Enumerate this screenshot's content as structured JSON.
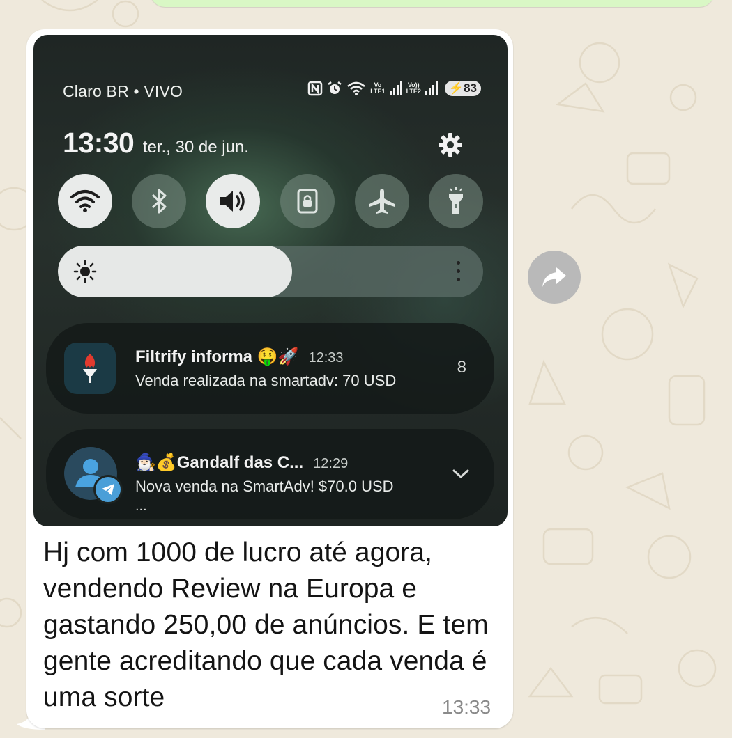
{
  "message": {
    "text": "Hj com 1000 de lucro até agora, vendendo Review na Europa e gastando 250,00 de anúncios. E tem gente acreditando que cada venda é uma sorte",
    "time": "13:33"
  },
  "screenshot": {
    "status_bar": {
      "carrier": "Claro BR • VIVO",
      "sim1_label_top": "Vo",
      "sim1_label_bottom": "LTE1",
      "sim2_label_top": "Vo))",
      "sim2_label_bottom": "LTE2",
      "battery": "83",
      "icons": [
        "nfc-icon",
        "alarm-icon",
        "wifi-icon",
        "signal-icon",
        "signal-icon",
        "battery-icon"
      ]
    },
    "header": {
      "clock": "13:30",
      "date": "ter., 30 de jun."
    },
    "quick_settings": [
      {
        "name": "wifi",
        "icon": "wifi-icon",
        "active": true
      },
      {
        "name": "bluetooth",
        "icon": "bluetooth-icon",
        "active": false
      },
      {
        "name": "sound",
        "icon": "volume-icon",
        "active": true
      },
      {
        "name": "rotation-lock",
        "icon": "lock-icon",
        "active": false
      },
      {
        "name": "airplane",
        "icon": "airplane-icon",
        "active": false
      },
      {
        "name": "flashlight",
        "icon": "flashlight-icon",
        "active": false
      }
    ],
    "brightness": {
      "level": 0.55
    },
    "notifications": [
      {
        "title": "Filtrify informa 🤑🚀",
        "time": "12:33",
        "body": "Venda realizada na smartadv: 70 USD",
        "count": "8"
      },
      {
        "title": "🧙🏻‍♂️💰Gandalf das C...",
        "time": "12:29",
        "body": "Nova venda na SmartAdv! $70.0 USD",
        "more": "..."
      }
    ]
  },
  "colors": {
    "chat_background": "#efe9dc",
    "bubble": "#ffffff",
    "forward_button": "#b9b9b9"
  }
}
